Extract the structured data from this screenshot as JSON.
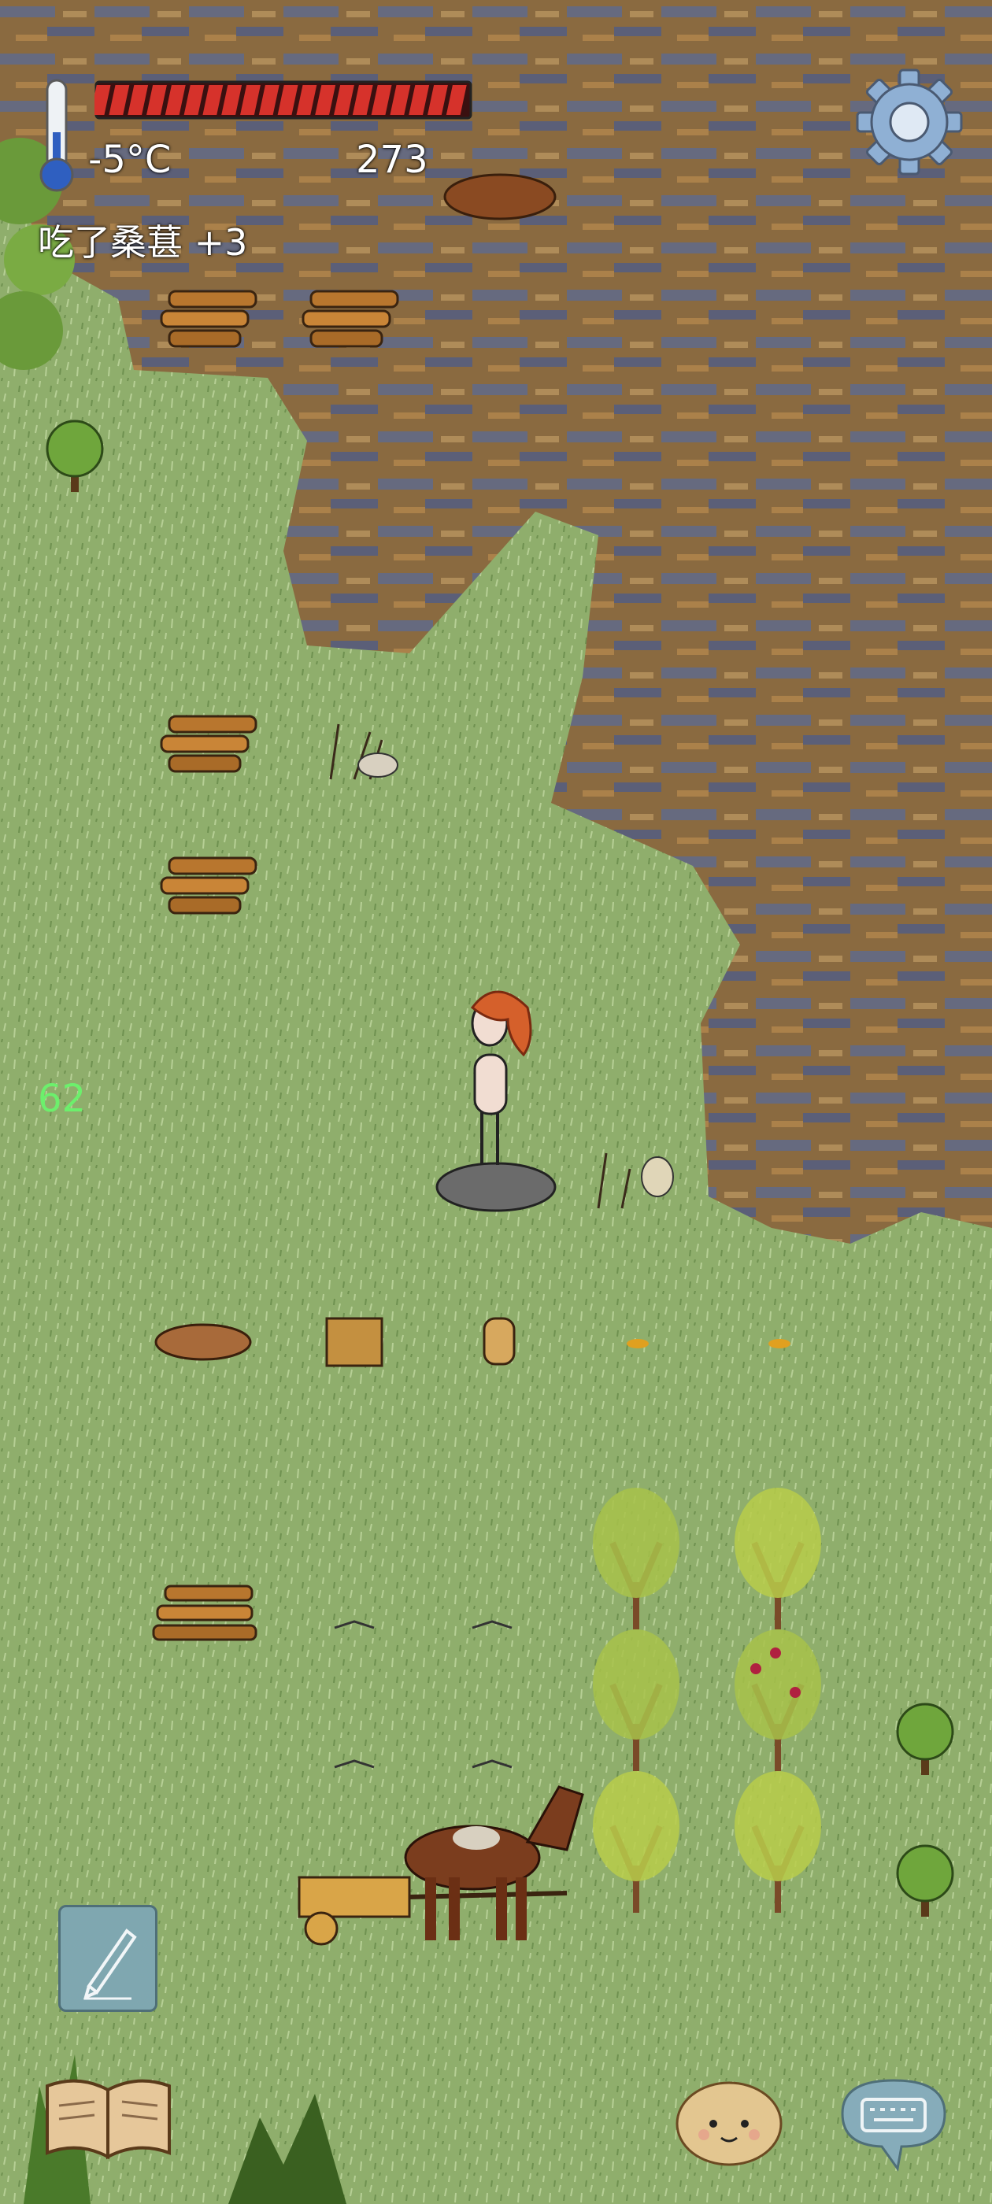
{
  "hud": {
    "temperature": "-5°C",
    "score": "273",
    "message": "吃了桑葚 +3",
    "fps": "62",
    "health_segments": 20
  },
  "icons": {
    "thermometer": "thermometer-icon",
    "settings": "gear-icon",
    "pencil": "pencil-icon",
    "journal": "open-book-icon",
    "emote": "potato-face-icon",
    "chat": "keyboard-speech-bubble-icon"
  },
  "colors": {
    "grass": "#8fae6c",
    "swamp": "#7a6a4a",
    "health_bar": "#d6322b",
    "fps_text": "#6cf06c"
  }
}
